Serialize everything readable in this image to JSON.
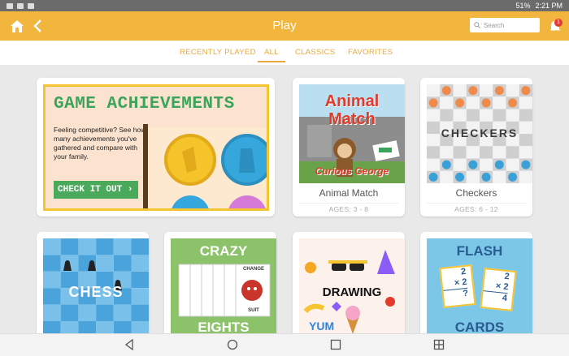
{
  "status": {
    "time": "2:21 PM",
    "battery": "51%"
  },
  "header": {
    "title": "Play",
    "search_placeholder": "Search",
    "notifications": "1"
  },
  "tabs": [
    {
      "label": "RECENTLY PLAYED"
    },
    {
      "label": "ALL"
    },
    {
      "label": "CLASSICS"
    },
    {
      "label": "FAVORITES"
    }
  ],
  "banner": {
    "title": "GAME ACHIEVEMENTS",
    "body": "Feeling competitive? See how many achievements you've gathered and compare with your family.",
    "cta": "CHECK IT OUT"
  },
  "games": [
    {
      "name": "Animal Match",
      "ages": "AGES: 3 - 8",
      "art_title": "Animal Match",
      "art_subtitle": "Curious George"
    },
    {
      "name": "Checkers",
      "ages": "AGES: 6 - 12",
      "art_title": "CHECKERS"
    },
    {
      "art_title": "CHESS"
    },
    {
      "art_title_top": "CRAZY",
      "art_title_bottom": "EIGHTS",
      "card_labels": [
        "CHANGE",
        "SUIT"
      ]
    },
    {
      "art_title": "DRAWING",
      "art_subtitle": "YUM"
    },
    {
      "art_title_top": "FLASH",
      "art_title_bottom": "CARDS",
      "flash1": {
        "a": "2",
        "b": "2",
        "ans": "?"
      },
      "flash2": {
        "a": "2",
        "b": "2",
        "ans": "4"
      }
    }
  ],
  "colors": {
    "accent": "#f2b63e",
    "tab_text": "#e8a93a",
    "green": "#3aa55a"
  }
}
